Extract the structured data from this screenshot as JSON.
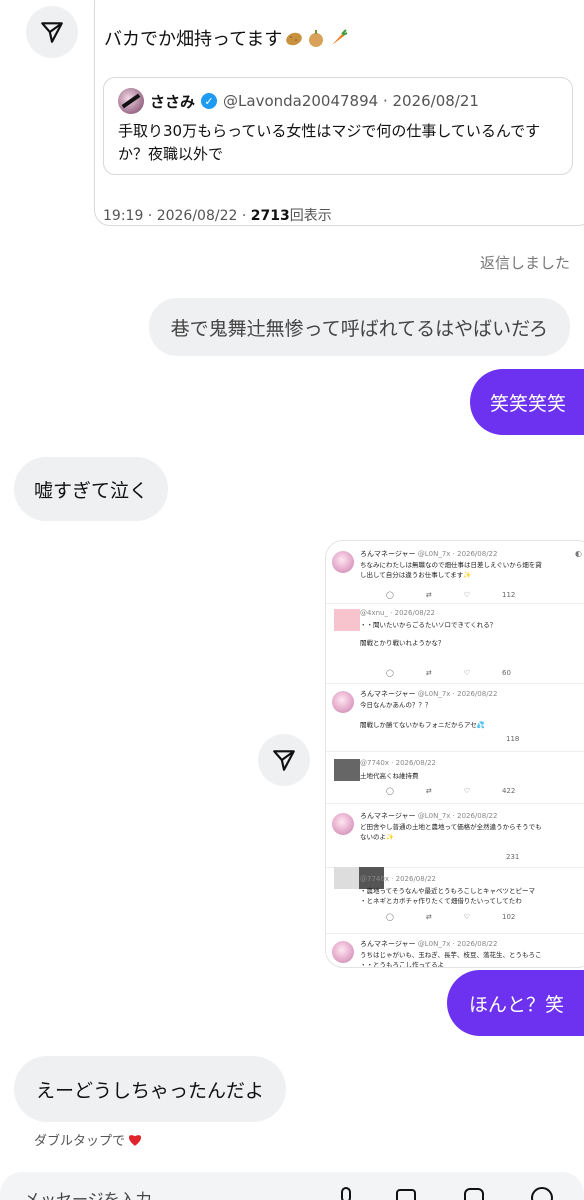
{
  "post": {
    "text": "バカでか畑持ってます",
    "emoji": [
      "potato",
      "onion",
      "carrot"
    ],
    "quote": {
      "name": "ささみ",
      "handle_date": "@Lavonda20047894 · 2026/08/21",
      "body": "手取り30万もらっている女性はマジで何の仕事しているんですか？夜職以外で"
    },
    "meta_time": "19:19 · 2026/08/22 · ",
    "meta_views": "2713",
    "meta_views_label": "回表示"
  },
  "status_replied": "返信しました",
  "messages": [
    {
      "id": "m1",
      "side": "right",
      "style": "gray",
      "text": "巷で鬼舞辻無惨って呼ばれてるはやばいだろ"
    },
    {
      "id": "m2",
      "side": "right",
      "style": "purple",
      "text": "笑笑笑笑"
    },
    {
      "id": "m3",
      "side": "left",
      "style": "gray",
      "text": "嘘すぎて泣く"
    },
    {
      "id": "m4",
      "side": "right",
      "style": "purple",
      "text": "ほんと？笑"
    },
    {
      "id": "m5",
      "side": "left",
      "style": "gray",
      "text": "えーどうしちゃったんだよ"
    }
  ],
  "screenshot": {
    "posts": [
      {
        "head": "ろんマネージャー",
        "handle": "@L0N_7x · 2026/08/22",
        "body": [
          "ちなみにわたしは無職なので畑仕事は日差しえぐいから畑を貸",
          "し出して自分は違うお仕事してます✨"
        ],
        "stat": "112"
      },
      {
        "head": "",
        "handle": "@4xnu_ · 2026/08/22",
        "body": [
          "・・聞いたいからごるたいソロできてくれる？",
          "闇戦とかり戦いれようかな？"
        ],
        "stat": "60"
      },
      {
        "head": "ろんマネージャー",
        "handle": "@L0N_7x · 2026/08/22",
        "body": [
          "今日なんかあんの？？？",
          "闇戦しか勝てないかもフォニだからアセ💦"
        ],
        "stat": "118"
      },
      {
        "head": "",
        "handle": "@7740x · 2026/08/22",
        "body": [
          "土地代高くね維持費"
        ],
        "stat": "422"
      },
      {
        "head": "ろんマネージャー",
        "handle": "@L0N_7x · 2026/08/22",
        "body": [
          "ど田舎やし普通の土地と農地って価格が全然違うからそうでも",
          "ないのよ✨"
        ],
        "stat": "231"
      },
      {
        "head": "",
        "handle": "@7740x · 2026/08/22",
        "body": [
          "・農地ってそうなんや最近とうもろこしとキャベツとピーマ",
          "・とネギとカボチャ作りたくて畑借りたいってしてたわ"
        ],
        "stat": "102"
      },
      {
        "head": "ろんマネージャー",
        "handle": "@L0N_7x · 2026/08/22",
        "body": [
          "うちはじゃがいも、玉ねぎ、長芋、枝豆、落花生、とうもろこ",
          "・・とうもろこし作ってるよ"
        ],
        "stat": ""
      }
    ]
  },
  "tap_hint": "ダブルタップで",
  "composer": {
    "placeholder": "メッセージを入力..."
  },
  "colors": {
    "accent": "#6d32f0",
    "bubble_gray": "#eff0f2",
    "verified": "#1d9bf0"
  }
}
